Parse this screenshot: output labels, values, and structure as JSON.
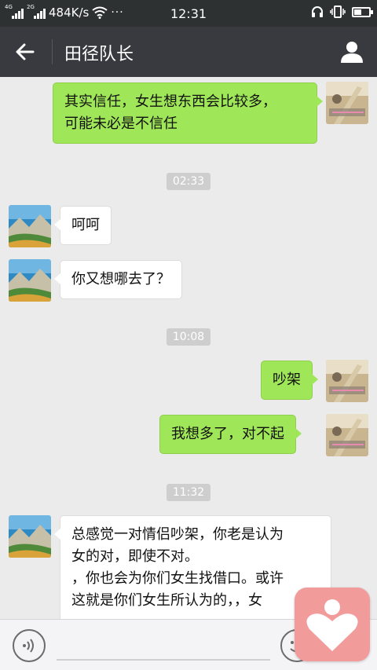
{
  "status_bar": {
    "net_speed": "484K/s",
    "time": "12:31",
    "sig1_label": "4G",
    "sig2_label": "2G",
    "more": "···"
  },
  "header": {
    "title": "田径队长",
    "back_icon": "arrow-left-icon",
    "profile_icon": "person-icon"
  },
  "messages": [
    {
      "side": "me",
      "text": "其实信任，女生想东西会比较多，\n可能未必是不信任"
    },
    {
      "time": "02:33"
    },
    {
      "side": "them",
      "text": "呵呵"
    },
    {
      "side": "them",
      "text": "你又想哪去了？"
    },
    {
      "time": "10:08"
    },
    {
      "side": "me",
      "text": "吵架"
    },
    {
      "side": "me",
      "text": "我想多了，对不起"
    },
    {
      "time": "11:32"
    },
    {
      "side": "them",
      "text": "总感觉一对情侣吵架，你老是认为\n女的对，即使不对。\n，你也会为你们女生找借口。或许\n这就是你们女生所认为的，，女"
    }
  ],
  "input_bar": {
    "voice_icon": "voice-icon",
    "emoji_icon": "emoji-icon"
  },
  "colors": {
    "my_bubble": "#9fe658",
    "their_bubble": "#ffffff",
    "nav_bg": "#393a3f",
    "chat_bg": "#ebebeb",
    "float_badge": "#f29b9b"
  }
}
